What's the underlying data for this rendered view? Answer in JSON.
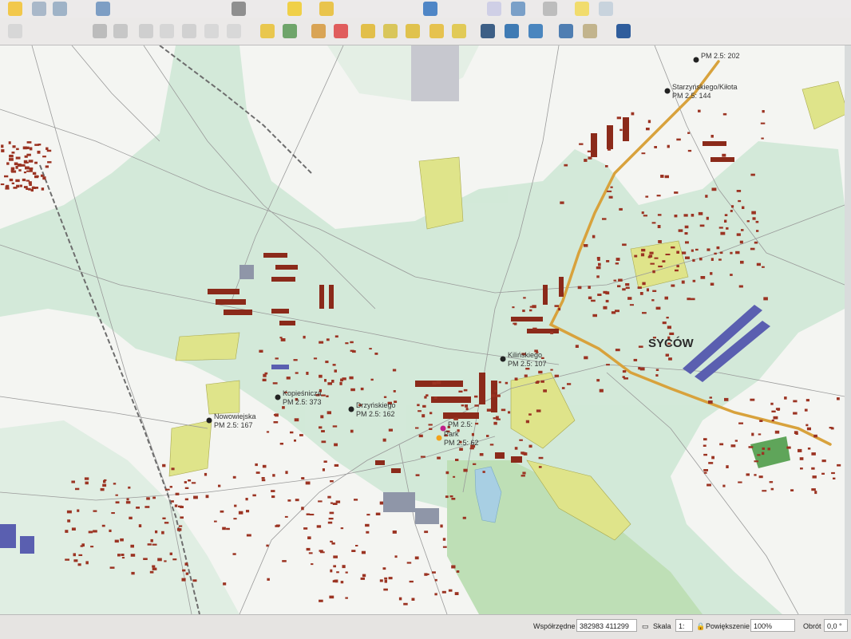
{
  "map": {
    "town_name": "SYCÓW",
    "stations": [
      {
        "name": "PM 2.5: 202",
        "label": ""
      },
      {
        "name": "Starzyńskiego/Kiłota",
        "label": "PM 2.5: 144"
      },
      {
        "name": "Kilińskiego",
        "label": "PM 2.5: 107"
      },
      {
        "name": "Kopieśnicza",
        "label": "PM 2.5: 373"
      },
      {
        "name": "Drzyńskiego",
        "label": "PM 2.5: 162"
      },
      {
        "name": "Nowowiejska",
        "label": "PM 2.5: 167"
      },
      {
        "name": "PM 2.5:",
        "label": ""
      },
      {
        "name": "Park",
        "label": "PM 2.5: 62"
      }
    ]
  },
  "statusbar": {
    "coords_label": "Współrzędne",
    "coords_value": "382983  411299",
    "scale_label": "Skala",
    "scale_value": "1:",
    "zoom_label": "Powiększenie",
    "zoom_value": "100%",
    "rotation_label": "Obrót",
    "rotation_value": "0,0 °"
  },
  "colors": {
    "building": "#8b2a1a",
    "green_area": "#cfe8d6",
    "yellow_area": "#dfe48a",
    "road_main": "#d8a23c",
    "industrial": "#5a5fb0"
  }
}
